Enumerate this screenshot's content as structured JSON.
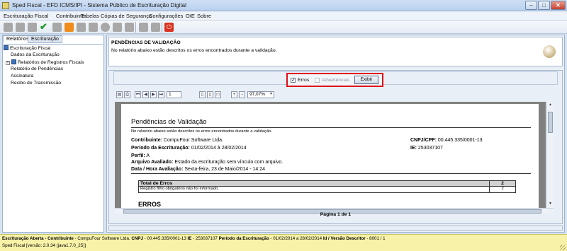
{
  "window": {
    "title": "Sped Fiscal - EFD ICMS/IPI - Sistema Público de Escrituração Digital",
    "minimize_glyph": "–",
    "maximize_glyph": "□",
    "close_glyph": "✕"
  },
  "menu": {
    "items": [
      "Escrituração Fiscal",
      "Contribuinte",
      "Tabelas",
      "Cópias de Segurança",
      "Configurações",
      "OIE",
      "Sobre"
    ]
  },
  "toolbar": {
    "icons": [
      "new-document-icon",
      "import-icon",
      "open-folder-icon",
      "validate-check-icon",
      "delete-icon",
      "export-icon",
      "print-icon",
      "sign-icon",
      "transmit-icon",
      "shield-icon",
      "certificate-icon",
      "save-icon",
      "restore-icon",
      "exit-icon"
    ]
  },
  "left_panel": {
    "tabs": [
      "Relatórios",
      "Escrituração"
    ],
    "tree": [
      {
        "label": "Escrituração Fiscal",
        "level": 0,
        "icon": "book-icon"
      },
      {
        "label": "Dados da Escrituração",
        "level": 1
      },
      {
        "label": "Relatórios de Registros Fiscais",
        "level": 1,
        "icon": "book-icon",
        "expandable": true
      },
      {
        "label": "Relatório de Pendências",
        "level": 1
      },
      {
        "label": "Assinatura",
        "level": 1
      },
      {
        "label": "Recibo de Transmissão",
        "level": 1
      }
    ]
  },
  "header": {
    "title": "PENDÊNCIAS DE VALIDAÇÃO",
    "description": "No relatório abaixo estão descritos os erros encontrados durante a validação."
  },
  "filter": {
    "erros_label": "Erros",
    "erros_checked": true,
    "advertencias_label": "Advertências",
    "advertencias_checked": false,
    "exibir_label": "Exibir",
    "highlight_color": "#e0101a"
  },
  "viewer": {
    "page_number": "1",
    "zoom": "97,07%",
    "page_label": "Página 1 de 1"
  },
  "report": {
    "title": "Pendências de Validação",
    "subtitle": "No relatório abaixo estão descritos os erros encontrados durante a validação.",
    "contribuinte_label": "Contribuinte:",
    "contribuinte": "CompuFour Software Ltda.",
    "cnpj_label": "CNPJ/CPF:",
    "cnpj": "00.445.335/0001-13",
    "periodo_label": "Período da Escrituração:",
    "periodo": "01/02/2014 à 28/02/2014",
    "ie_label": "IE:",
    "ie": "253037107",
    "perfil_label": "Perfil:",
    "perfil": "A",
    "arquivo_label": "Arquivo Avaliado:",
    "arquivo": "Estado da escrituração sem vínculo com arquivo.",
    "data_label": "Data / Hora Avaliação:",
    "data": "Sexta-feira, 23 de Maio/2014 - 14:24",
    "total_label": "Total de Erros",
    "total_value": "2",
    "row_label": "Registro filho obrigatório não foi informado.",
    "row_value": "2",
    "erros_heading": "ERROS"
  },
  "status": {
    "line1_prefix": "Escrituração Aberta - Contribuinte",
    "line1_contribuinte": " - CompuFour Software Ltda.",
    "line1_cnpj_label": " CNPJ",
    "line1_cnpj": " - 00.445.335/0001-13",
    "line1_ie_label": " IE",
    "line1_ie": " - 253037107",
    "line1_periodo_label": " Período da Escrituração",
    "line1_periodo": " - 01/02/2014 a 28/02/2014",
    "line1_versao_label": " Id / Versão Descritor",
    "line1_versao": " - 8001 / 1",
    "line2": "Sped Fiscal [versão: 2.0.34 (java1.7.0_25)]"
  }
}
